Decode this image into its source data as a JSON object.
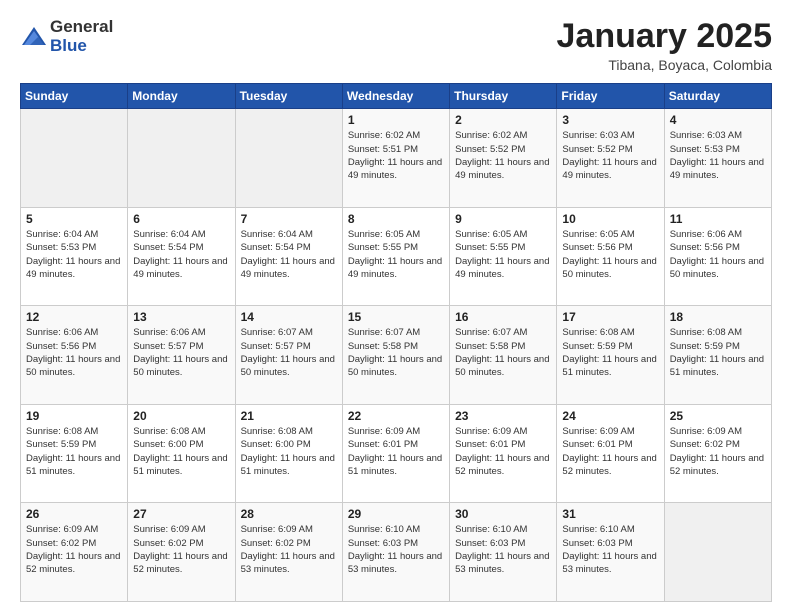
{
  "logo": {
    "general": "General",
    "blue": "Blue"
  },
  "header": {
    "title": "January 2025",
    "location": "Tibana, Boyaca, Colombia"
  },
  "weekdays": [
    "Sunday",
    "Monday",
    "Tuesday",
    "Wednesday",
    "Thursday",
    "Friday",
    "Saturday"
  ],
  "weeks": [
    [
      {
        "day": "",
        "sunrise": "",
        "sunset": "",
        "daylight": ""
      },
      {
        "day": "",
        "sunrise": "",
        "sunset": "",
        "daylight": ""
      },
      {
        "day": "",
        "sunrise": "",
        "sunset": "",
        "daylight": ""
      },
      {
        "day": "1",
        "sunrise": "Sunrise: 6:02 AM",
        "sunset": "Sunset: 5:51 PM",
        "daylight": "Daylight: 11 hours and 49 minutes."
      },
      {
        "day": "2",
        "sunrise": "Sunrise: 6:02 AM",
        "sunset": "Sunset: 5:52 PM",
        "daylight": "Daylight: 11 hours and 49 minutes."
      },
      {
        "day": "3",
        "sunrise": "Sunrise: 6:03 AM",
        "sunset": "Sunset: 5:52 PM",
        "daylight": "Daylight: 11 hours and 49 minutes."
      },
      {
        "day": "4",
        "sunrise": "Sunrise: 6:03 AM",
        "sunset": "Sunset: 5:53 PM",
        "daylight": "Daylight: 11 hours and 49 minutes."
      }
    ],
    [
      {
        "day": "5",
        "sunrise": "Sunrise: 6:04 AM",
        "sunset": "Sunset: 5:53 PM",
        "daylight": "Daylight: 11 hours and 49 minutes."
      },
      {
        "day": "6",
        "sunrise": "Sunrise: 6:04 AM",
        "sunset": "Sunset: 5:54 PM",
        "daylight": "Daylight: 11 hours and 49 minutes."
      },
      {
        "day": "7",
        "sunrise": "Sunrise: 6:04 AM",
        "sunset": "Sunset: 5:54 PM",
        "daylight": "Daylight: 11 hours and 49 minutes."
      },
      {
        "day": "8",
        "sunrise": "Sunrise: 6:05 AM",
        "sunset": "Sunset: 5:55 PM",
        "daylight": "Daylight: 11 hours and 49 minutes."
      },
      {
        "day": "9",
        "sunrise": "Sunrise: 6:05 AM",
        "sunset": "Sunset: 5:55 PM",
        "daylight": "Daylight: 11 hours and 49 minutes."
      },
      {
        "day": "10",
        "sunrise": "Sunrise: 6:05 AM",
        "sunset": "Sunset: 5:56 PM",
        "daylight": "Daylight: 11 hours and 50 minutes."
      },
      {
        "day": "11",
        "sunrise": "Sunrise: 6:06 AM",
        "sunset": "Sunset: 5:56 PM",
        "daylight": "Daylight: 11 hours and 50 minutes."
      }
    ],
    [
      {
        "day": "12",
        "sunrise": "Sunrise: 6:06 AM",
        "sunset": "Sunset: 5:56 PM",
        "daylight": "Daylight: 11 hours and 50 minutes."
      },
      {
        "day": "13",
        "sunrise": "Sunrise: 6:06 AM",
        "sunset": "Sunset: 5:57 PM",
        "daylight": "Daylight: 11 hours and 50 minutes."
      },
      {
        "day": "14",
        "sunrise": "Sunrise: 6:07 AM",
        "sunset": "Sunset: 5:57 PM",
        "daylight": "Daylight: 11 hours and 50 minutes."
      },
      {
        "day": "15",
        "sunrise": "Sunrise: 6:07 AM",
        "sunset": "Sunset: 5:58 PM",
        "daylight": "Daylight: 11 hours and 50 minutes."
      },
      {
        "day": "16",
        "sunrise": "Sunrise: 6:07 AM",
        "sunset": "Sunset: 5:58 PM",
        "daylight": "Daylight: 11 hours and 50 minutes."
      },
      {
        "day": "17",
        "sunrise": "Sunrise: 6:08 AM",
        "sunset": "Sunset: 5:59 PM",
        "daylight": "Daylight: 11 hours and 51 minutes."
      },
      {
        "day": "18",
        "sunrise": "Sunrise: 6:08 AM",
        "sunset": "Sunset: 5:59 PM",
        "daylight": "Daylight: 11 hours and 51 minutes."
      }
    ],
    [
      {
        "day": "19",
        "sunrise": "Sunrise: 6:08 AM",
        "sunset": "Sunset: 5:59 PM",
        "daylight": "Daylight: 11 hours and 51 minutes."
      },
      {
        "day": "20",
        "sunrise": "Sunrise: 6:08 AM",
        "sunset": "Sunset: 6:00 PM",
        "daylight": "Daylight: 11 hours and 51 minutes."
      },
      {
        "day": "21",
        "sunrise": "Sunrise: 6:08 AM",
        "sunset": "Sunset: 6:00 PM",
        "daylight": "Daylight: 11 hours and 51 minutes."
      },
      {
        "day": "22",
        "sunrise": "Sunrise: 6:09 AM",
        "sunset": "Sunset: 6:01 PM",
        "daylight": "Daylight: 11 hours and 51 minutes."
      },
      {
        "day": "23",
        "sunrise": "Sunrise: 6:09 AM",
        "sunset": "Sunset: 6:01 PM",
        "daylight": "Daylight: 11 hours and 52 minutes."
      },
      {
        "day": "24",
        "sunrise": "Sunrise: 6:09 AM",
        "sunset": "Sunset: 6:01 PM",
        "daylight": "Daylight: 11 hours and 52 minutes."
      },
      {
        "day": "25",
        "sunrise": "Sunrise: 6:09 AM",
        "sunset": "Sunset: 6:02 PM",
        "daylight": "Daylight: 11 hours and 52 minutes."
      }
    ],
    [
      {
        "day": "26",
        "sunrise": "Sunrise: 6:09 AM",
        "sunset": "Sunset: 6:02 PM",
        "daylight": "Daylight: 11 hours and 52 minutes."
      },
      {
        "day": "27",
        "sunrise": "Sunrise: 6:09 AM",
        "sunset": "Sunset: 6:02 PM",
        "daylight": "Daylight: 11 hours and 52 minutes."
      },
      {
        "day": "28",
        "sunrise": "Sunrise: 6:09 AM",
        "sunset": "Sunset: 6:02 PM",
        "daylight": "Daylight: 11 hours and 53 minutes."
      },
      {
        "day": "29",
        "sunrise": "Sunrise: 6:10 AM",
        "sunset": "Sunset: 6:03 PM",
        "daylight": "Daylight: 11 hours and 53 minutes."
      },
      {
        "day": "30",
        "sunrise": "Sunrise: 6:10 AM",
        "sunset": "Sunset: 6:03 PM",
        "daylight": "Daylight: 11 hours and 53 minutes."
      },
      {
        "day": "31",
        "sunrise": "Sunrise: 6:10 AM",
        "sunset": "Sunset: 6:03 PM",
        "daylight": "Daylight: 11 hours and 53 minutes."
      },
      {
        "day": "",
        "sunrise": "",
        "sunset": "",
        "daylight": ""
      }
    ]
  ]
}
